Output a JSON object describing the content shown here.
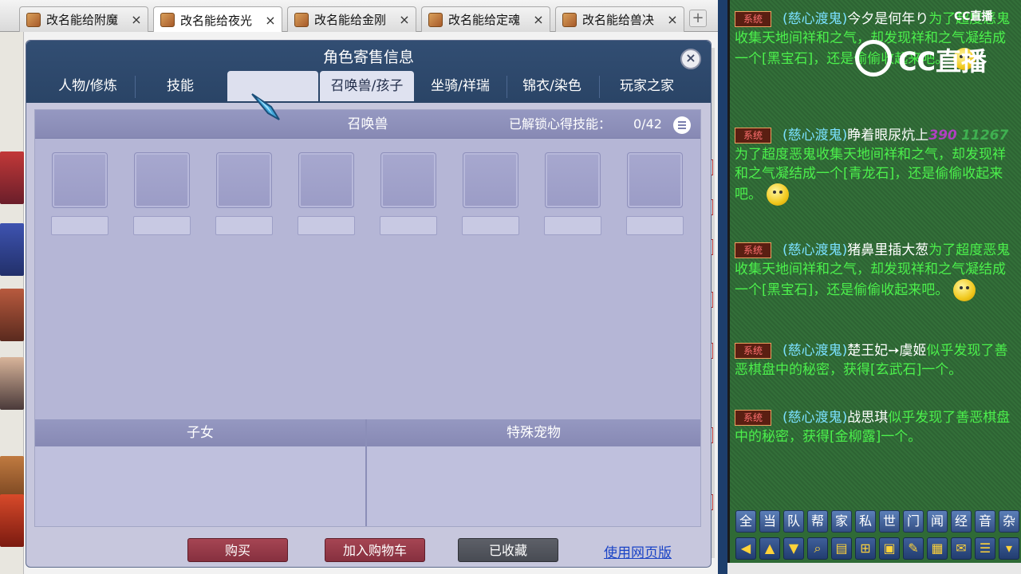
{
  "browser": {
    "tabs": [
      {
        "label": "改名能给附魔",
        "close": "×"
      },
      {
        "label": "改名能给夜光",
        "close": "×"
      },
      {
        "label": "改名能给金刚",
        "close": "×"
      },
      {
        "label": "改名能给定魂",
        "close": "×"
      },
      {
        "label": "改名能给兽决",
        "close": "×"
      }
    ],
    "new_tab": "+",
    "active_tab_index": 1
  },
  "dialog": {
    "title": "角色寄售信息",
    "close": "×",
    "tabs": [
      "人物/修炼",
      "技能",
      "",
      "召唤兽/孩子",
      "坐骑/祥瑞",
      "锦衣/染色",
      "玩家之家"
    ],
    "pet_section": {
      "title": "召唤兽",
      "skill_label": "已解锁心得技能：",
      "skill_count": "0/42",
      "slot_count": 8
    },
    "child_section": {
      "title": "子女"
    },
    "special_section": {
      "title": "特殊宠物"
    },
    "buttons": {
      "buy": "购买",
      "add_cart": "加入购物车",
      "favorited": "已收藏",
      "web_link": "使用网页版"
    }
  },
  "chat": {
    "system_badge": "系统",
    "sender": "(慈心渡鬼)",
    "logo": "CC直播",
    "logo_small": "CC直播",
    "messages": [
      {
        "name": "今夕是何年り",
        "text": "为了超度恶鬼收集天地间祥和之气，却发现祥和之气凝结成一个[黑宝石]，还是偷偷收起来吧。"
      },
      {
        "name": "睁着眼尿炕上",
        "deco1": "390",
        "deco2": "11267",
        "text": "为了超度恶鬼收集天地间祥和之气，却发现祥和之气凝结成一个[青龙石]，还是偷偷收起来吧。"
      },
      {
        "name": "猪鼻里插大葱",
        "text": "为了超度恶鬼收集天地间祥和之气，却发现祥和之气凝结成一个[黑宝石]，还是偷偷收起来吧。"
      },
      {
        "name": "楚王妃➙虞姬",
        "text": "似乎发现了善恶棋盘中的秘密，获得[玄武石]一个。"
      },
      {
        "name": "战思琪",
        "text": "似乎发现了善恶棋盘中的秘密，获得[金柳露]一个。"
      }
    ],
    "channel_buttons": [
      "全",
      "当",
      "队",
      "帮",
      "家",
      "私",
      "世",
      "门",
      "闻",
      "经",
      "音",
      "杂"
    ],
    "tool_icons": [
      "◀",
      "▲",
      "▼",
      "⌕",
      "▤",
      "⊞",
      "▣",
      "✎",
      "▦",
      "✉",
      "☰",
      "▾"
    ]
  }
}
